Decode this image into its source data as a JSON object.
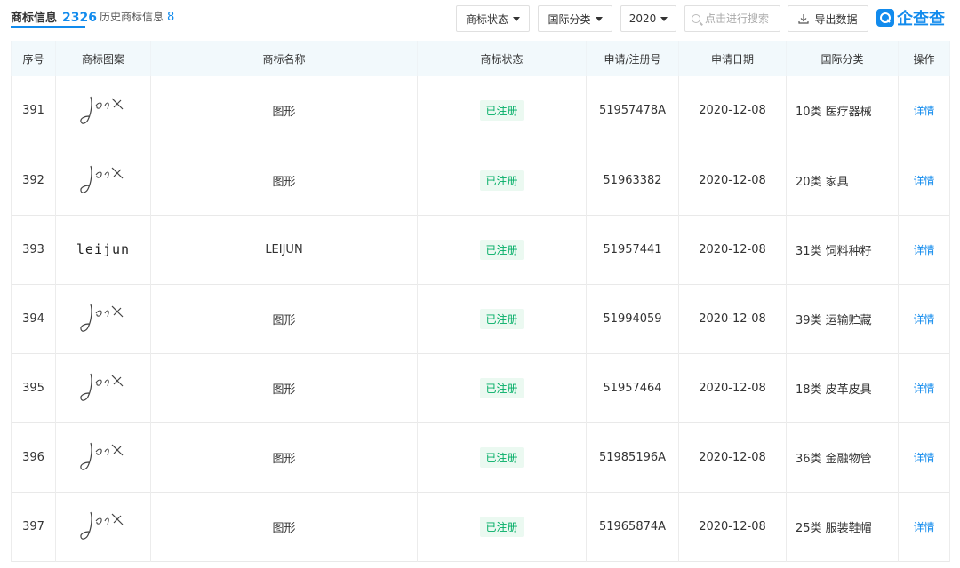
{
  "header": {
    "tab_main_label": "商标信息",
    "tab_main_count": "2326",
    "tab_history_label": "历史商标信息",
    "tab_history_count": "8"
  },
  "filters": {
    "status_label": "商标状态",
    "class_label": "国际分类",
    "year_label": "2020",
    "search_placeholder": "点击进行搜索",
    "export_label": "导出数据"
  },
  "brand": {
    "logo_text": "企查查",
    "accent_color": "#128bed"
  },
  "table": {
    "columns": [
      "序号",
      "商标图案",
      "商标名称",
      "商标状态",
      "申请/注册号",
      "申请日期",
      "国际分类",
      "操作"
    ],
    "rows": [
      {
        "index": "391",
        "image": "signature",
        "name": "图形",
        "status": "已注册",
        "reg_no": "51957478A",
        "date": "2020-12-08",
        "class": "10类 医疗器械",
        "action": "详情"
      },
      {
        "index": "392",
        "image": "signature",
        "name": "图形",
        "status": "已注册",
        "reg_no": "51963382",
        "date": "2020-12-08",
        "class": "20类 家具",
        "action": "详情"
      },
      {
        "index": "393",
        "image": "leijun",
        "image_text": "leijun",
        "name": "LEIJUN",
        "status": "已注册",
        "reg_no": "51957441",
        "date": "2020-12-08",
        "class": "31类 饲料种籽",
        "action": "详情"
      },
      {
        "index": "394",
        "image": "signature",
        "name": "图形",
        "status": "已注册",
        "reg_no": "51994059",
        "date": "2020-12-08",
        "class": "39类 运输贮藏",
        "action": "详情"
      },
      {
        "index": "395",
        "image": "signature",
        "name": "图形",
        "status": "已注册",
        "reg_no": "51957464",
        "date": "2020-12-08",
        "class": "18类 皮革皮具",
        "action": "详情"
      },
      {
        "index": "396",
        "image": "signature",
        "name": "图形",
        "status": "已注册",
        "reg_no": "51985196A",
        "date": "2020-12-08",
        "class": "36类 金融物管",
        "action": "详情"
      },
      {
        "index": "397",
        "image": "signature",
        "name": "图形",
        "status": "已注册",
        "reg_no": "51965874A",
        "date": "2020-12-08",
        "class": "25类 服装鞋帽",
        "action": "详情"
      }
    ]
  },
  "colors": {
    "status_green": "#00ad65",
    "status_bg": "#ebf9f1",
    "header_bg": "#f2f9fc"
  }
}
